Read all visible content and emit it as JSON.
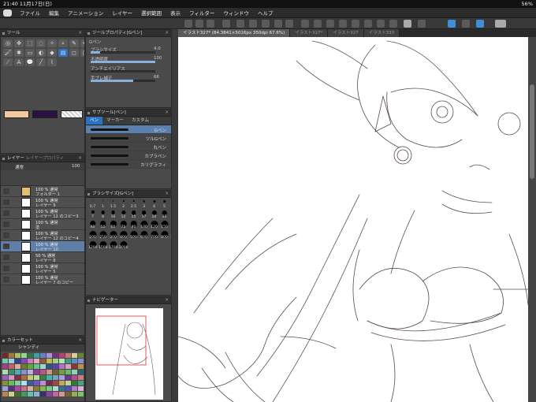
{
  "status": {
    "time": "21:40",
    "date": "11月17日(日)",
    "battery": "56%"
  },
  "menu": [
    "ファイル",
    "編集",
    "アニメーション",
    "レイヤー",
    "選択範囲",
    "表示",
    "フィルター",
    "ウィンドウ",
    "ヘルプ"
  ],
  "tabs": [
    "イラスト327* (84.3841×5016px 350dpi 67.6%)",
    "イラスト327*",
    "イラスト327",
    "イラスト333"
  ],
  "tool_panel": {
    "title": "ツール"
  },
  "tool_property": {
    "title": "ツールプロパティ[Gペン]",
    "tool_name": "Gペン",
    "rows": [
      {
        "label": "ブラシサイズ",
        "value": "4.0",
        "fill": 0.15
      },
      {
        "label": "不透明度",
        "value": "100",
        "fill": 1.0
      },
      {
        "label": "アンチエイリアス",
        "value": "",
        "fill": 0
      },
      {
        "label": "手ブレ補正",
        "value": "66",
        "fill": 0.66
      }
    ]
  },
  "subtool": {
    "title": "サブツール[ペン]",
    "tabs": [
      "ペン",
      "マーカー",
      "カスタム"
    ],
    "brushes": [
      "Gペン",
      "ツルGペン",
      "丸ペン",
      "カブラペン",
      "カリグラフィ"
    ]
  },
  "brush_size": {
    "title": "ブラシサイズ[Gペン]",
    "sizes": [
      "0.7",
      "1",
      "1.5",
      "2",
      "2.5",
      "3",
      "4",
      "5",
      "6",
      "7",
      "8",
      "10",
      "12",
      "15",
      "17",
      "20",
      "25",
      "30",
      "40",
      "50",
      "60",
      "70",
      "80",
      "100",
      "120",
      "150",
      "170",
      "200",
      "250",
      "300",
      "400",
      "500",
      "600",
      "700",
      "800",
      "1000",
      "1200",
      "1500",
      "1700",
      "2000"
    ]
  },
  "navigator": {
    "title": "ナビゲーター"
  },
  "layer_panel": {
    "title": "レイヤー",
    "tab2": "レイヤープロパティ",
    "blend": "通常",
    "opacity": "100",
    "layers": [
      {
        "line1": "100 % 通常",
        "line2": "フォルダー 1",
        "selected": false
      },
      {
        "line1": "100 % 通常",
        "line2": "レイヤー 9",
        "selected": false
      },
      {
        "line1": "100 % 通常",
        "line2": "レイヤー 12 のコピー3",
        "selected": false
      },
      {
        "line1": "100 % 通常",
        "line2": "塗",
        "selected": false
      },
      {
        "line1": "100 % 通常",
        "line2": "レイヤー 12 のコピー4",
        "selected": false
      },
      {
        "line1": "100 % 通常",
        "line2": "レイヤー 10",
        "selected": true
      },
      {
        "line1": "50 % 通常",
        "line2": "レイヤー 8",
        "selected": false
      },
      {
        "line1": "100 % 通常",
        "line2": "レイヤー 5",
        "selected": false
      },
      {
        "line1": "100 % 通常",
        "line2": "レイヤー 7 のコピー",
        "selected": false
      }
    ]
  },
  "color_set": {
    "title": "カラーセット",
    "set_name": "シャンディ"
  },
  "colors": {
    "main": "#f2c8a0",
    "sub": "#2a1240",
    "accent": "#2d73c2"
  }
}
